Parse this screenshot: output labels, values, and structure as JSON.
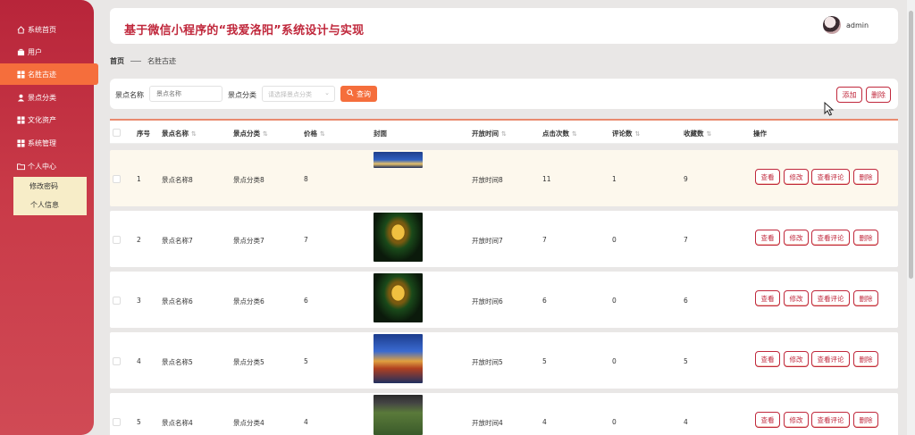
{
  "sidebar": {
    "items": [
      {
        "label": "系统首页",
        "icon": "home-icon"
      },
      {
        "label": "用户",
        "icon": "briefcase-icon"
      },
      {
        "label": "名胜古迹",
        "icon": "grid-icon",
        "active": true
      },
      {
        "label": "景点分类",
        "icon": "person-icon"
      },
      {
        "label": "文化资产",
        "icon": "grid-icon"
      },
      {
        "label": "系统管理",
        "icon": "grid-icon"
      },
      {
        "label": "个人中心",
        "icon": "folder-icon"
      }
    ],
    "submenu": [
      "修改密码",
      "个人信息"
    ]
  },
  "header": {
    "title": "基于微信小程序的“我爱洛阳”系统设计与实现",
    "username": "admin"
  },
  "breadcrumb": {
    "home": "首页",
    "current": "名胜古迹"
  },
  "search": {
    "name_label": "景点名称",
    "name_placeholder": "景点名称",
    "category_label": "景点分类",
    "category_placeholder": "请选择景点分类",
    "query_label": "查询",
    "add_label": "添加",
    "delete_label": "删除"
  },
  "table": {
    "columns": [
      "序号",
      "景点名称",
      "景点分类",
      "价格",
      "封面",
      "开放时间",
      "点击次数",
      "评论数",
      "收藏数",
      "操作"
    ],
    "rows": [
      {
        "index": "1",
        "name": "景点名称8",
        "category": "景点分类8",
        "price": "8",
        "open_time": "开放时间8",
        "clicks": "11",
        "comments": "1",
        "favorites": "9"
      },
      {
        "index": "2",
        "name": "景点名称7",
        "category": "景点分类7",
        "price": "7",
        "open_time": "开放时间7",
        "clicks": "7",
        "comments": "0",
        "favorites": "7"
      },
      {
        "index": "3",
        "name": "景点名称6",
        "category": "景点分类6",
        "price": "6",
        "open_time": "开放时间6",
        "clicks": "6",
        "comments": "0",
        "favorites": "6"
      },
      {
        "index": "4",
        "name": "景点名称5",
        "category": "景点分类5",
        "price": "5",
        "open_time": "开放时间5",
        "clicks": "5",
        "comments": "0",
        "favorites": "5"
      },
      {
        "index": "5",
        "name": "景点名称4",
        "category": "景点分类4",
        "price": "4",
        "open_time": "开放时间4",
        "clicks": "4",
        "comments": "0",
        "favorites": "4"
      }
    ],
    "actions": [
      "查看",
      "修改",
      "查看评论",
      "删除"
    ]
  },
  "colors": {
    "primary": "#c0283c",
    "accent": "#f56e3c",
    "submenu_bg": "#f7edc8"
  }
}
